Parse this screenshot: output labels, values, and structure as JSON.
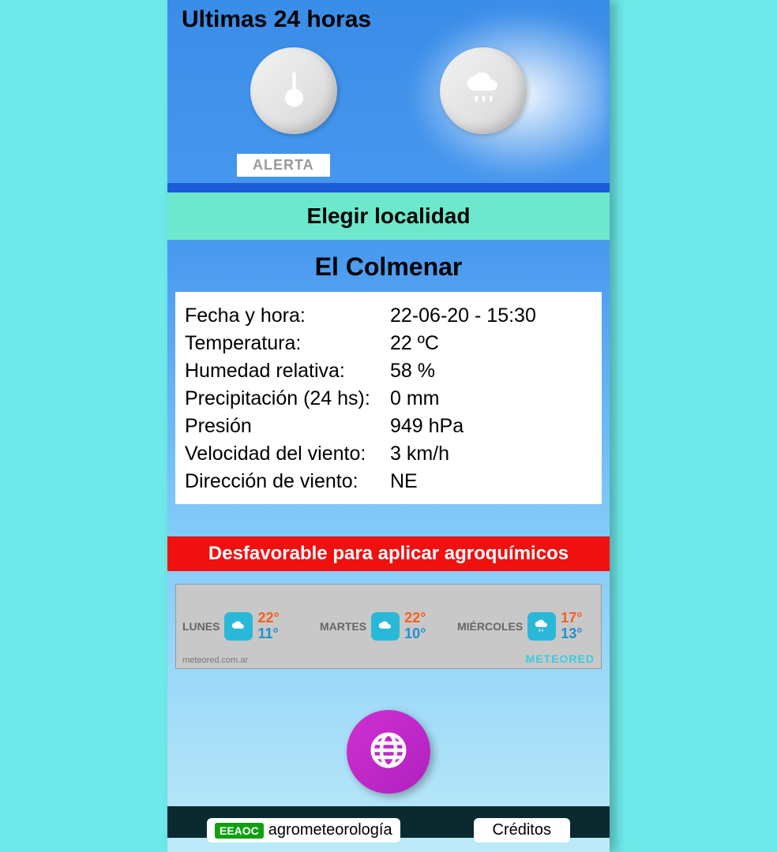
{
  "header": {
    "title": "Ultimas 24 horas"
  },
  "icons": {
    "alert_label": "ALERTA"
  },
  "locality_bar": {
    "label": "Elegir localidad"
  },
  "location": {
    "name": "El Colmenar"
  },
  "readings": {
    "datetime_label": "Fecha y hora:",
    "datetime_value": "22-06-20 - 15:30",
    "temp_label": "Temperatura:",
    "temp_value": "22 ºC",
    "humidity_label": "Humedad relativa:",
    "humidity_value": "58 %",
    "precip_label": "Precipitación (24 hs):",
    "precip_value": "0 mm",
    "pressure_label": "Presión",
    "pressure_value": "949 hPa",
    "windspeed_label": "Velocidad del viento:",
    "windspeed_value": "3 km/h",
    "winddir_label": "Dirección de viento:",
    "winddir_value": "NE"
  },
  "agro_banner": {
    "text": "Desfavorable para aplicar agroquímicos"
  },
  "forecast": {
    "days": [
      {
        "name": "LUNES",
        "hi": "22°",
        "lo": "11°",
        "condition": "cloudy"
      },
      {
        "name": "MARTES",
        "hi": "22°",
        "lo": "10°",
        "condition": "cloudy"
      },
      {
        "name": "MIÉRCOLES",
        "hi": "17°",
        "lo": "13°",
        "condition": "rain"
      }
    ],
    "attribution": "meteored.com.ar",
    "brand": "METEORED"
  },
  "footer": {
    "eeaoc_tag": "EEAOC",
    "agromet": "agrometeorología",
    "credits": "Créditos"
  }
}
